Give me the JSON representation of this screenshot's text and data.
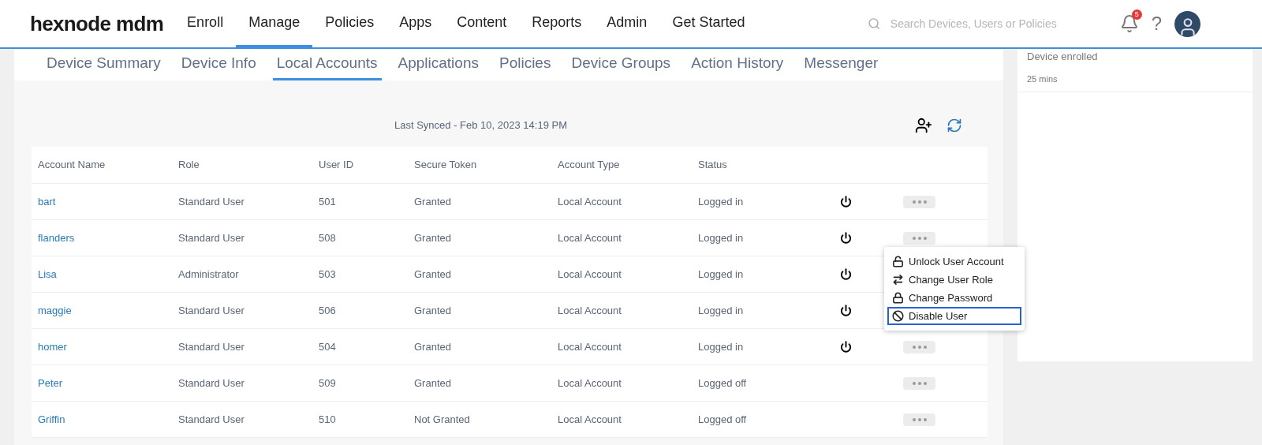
{
  "logo": "hexnode mdm",
  "nav": [
    {
      "label": "Enroll",
      "selected": false
    },
    {
      "label": "Manage",
      "selected": true
    },
    {
      "label": "Policies",
      "selected": false
    },
    {
      "label": "Apps",
      "selected": false
    },
    {
      "label": "Content",
      "selected": false
    },
    {
      "label": "Reports",
      "selected": false
    },
    {
      "label": "Admin",
      "selected": false
    },
    {
      "label": "Get Started",
      "selected": false
    }
  ],
  "search": {
    "placeholder": "Search Devices, Users or Policies"
  },
  "notifications": {
    "count": "5"
  },
  "help": "?",
  "subtabs": [
    {
      "label": "Device Summary",
      "selected": false
    },
    {
      "label": "Device Info",
      "selected": false
    },
    {
      "label": "Local Accounts",
      "selected": true
    },
    {
      "label": "Applications",
      "selected": false
    },
    {
      "label": "Policies",
      "selected": false
    },
    {
      "label": "Device Groups",
      "selected": false
    },
    {
      "label": "Action History",
      "selected": false
    },
    {
      "label": "Messenger",
      "selected": false
    }
  ],
  "last_synced": "Last Synced - Feb 10, 2023 14:19 PM",
  "table": {
    "columns": [
      "Account Name",
      "Role",
      "User ID",
      "Secure Token",
      "Account Type",
      "Status"
    ],
    "rows": [
      {
        "cells": [
          "bart",
          "Standard User",
          "501",
          "Granted",
          "Local Account",
          "Logged in"
        ],
        "power": true
      },
      {
        "cells": [
          "flanders",
          "Standard User",
          "508",
          "Granted",
          "Local Account",
          "Logged in"
        ],
        "power": true,
        "menu": [
          {
            "kind": "unlock",
            "label": "Unlock User Account",
            "selected": false
          },
          {
            "kind": "swap",
            "label": "Change User Role",
            "selected": false
          },
          {
            "kind": "lock",
            "label": "Change Password",
            "selected": false
          },
          {
            "kind": "disable",
            "label": "Disable User",
            "selected": true
          }
        ]
      },
      {
        "cells": [
          "Lisa",
          "Administrator",
          "503",
          "Granted",
          "Local Account",
          "Logged in"
        ],
        "power": true
      },
      {
        "cells": [
          "maggie",
          "Standard User",
          "506",
          "Granted",
          "Local Account",
          "Logged in"
        ],
        "power": true
      },
      {
        "cells": [
          "homer",
          "Standard User",
          "504",
          "Granted",
          "Local Account",
          "Logged in"
        ],
        "power": true
      },
      {
        "cells": [
          "Peter",
          "Standard User",
          "509",
          "Granted",
          "Local Account",
          "Logged off"
        ],
        "power": false
      },
      {
        "cells": [
          "Griffin",
          "Standard User",
          "510",
          "Not Granted",
          "Local Account",
          "Logged off"
        ],
        "power": false
      }
    ]
  },
  "activity": {
    "title": "Device enrolled",
    "time": "25 mins"
  }
}
